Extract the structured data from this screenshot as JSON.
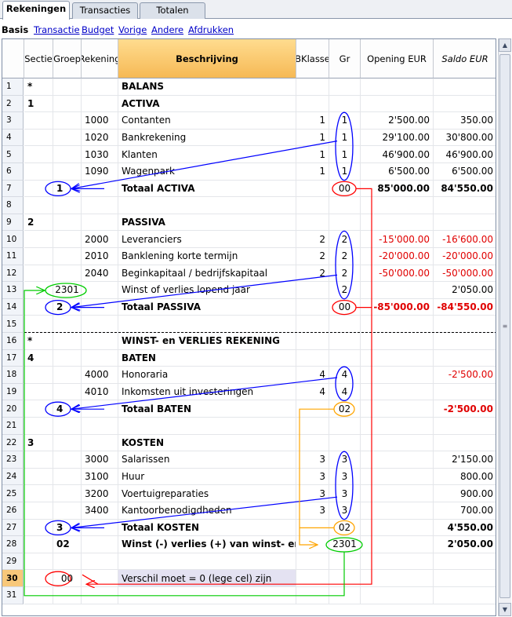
{
  "tabs": [
    {
      "label": "Rekeningen",
      "active": true
    },
    {
      "label": "Transacties",
      "active": false
    },
    {
      "label": "Totalen",
      "active": false
    }
  ],
  "subnav": [
    {
      "label": "Basis",
      "active": true
    },
    {
      "label": "Transactie",
      "active": false
    },
    {
      "label": "Budget",
      "active": false
    },
    {
      "label": "Vorige",
      "active": false
    },
    {
      "label": "Andere",
      "active": false
    },
    {
      "label": "Afdrukken",
      "active": false
    }
  ],
  "columns": [
    "Sectie",
    "Groep",
    "Rekening",
    "Beschrijving",
    "BKlasse",
    "Gr",
    "Opening EUR",
    "Saldo EUR"
  ],
  "rows": [
    {
      "n": "1",
      "sectie": "*",
      "groep": "",
      "rekening": "",
      "beschrijving": "BALANS",
      "bklasse": "",
      "gr": "",
      "opening": "",
      "saldo": "",
      "bold": true
    },
    {
      "n": "2",
      "sectie": "1",
      "groep": "",
      "rekening": "",
      "beschrijving": "ACTIVA",
      "bklasse": "",
      "gr": "",
      "opening": "",
      "saldo": "",
      "bold": true
    },
    {
      "n": "3",
      "sectie": "",
      "groep": "",
      "rekening": "1000",
      "beschrijving": "Contanten",
      "bklasse": "1",
      "gr": "1",
      "opening": "2'500.00",
      "saldo": "350.00"
    },
    {
      "n": "4",
      "sectie": "",
      "groep": "",
      "rekening": "1020",
      "beschrijving": "Bankrekening",
      "bklasse": "1",
      "gr": "1",
      "opening": "29'100.00",
      "saldo": "30'800.00"
    },
    {
      "n": "5",
      "sectie": "",
      "groep": "",
      "rekening": "1030",
      "beschrijving": "Klanten",
      "bklasse": "1",
      "gr": "1",
      "opening": "46'900.00",
      "saldo": "46'900.00"
    },
    {
      "n": "6",
      "sectie": "",
      "groep": "",
      "rekening": "1090",
      "beschrijving": "Wagenpark",
      "bklasse": "1",
      "gr": "1",
      "opening": "6'500.00",
      "saldo": "6'500.00"
    },
    {
      "n": "7",
      "sectie": "",
      "groep": "1",
      "rekening": "",
      "beschrijving": "Totaal  ACTIVA",
      "bklasse": "",
      "gr": "00",
      "opening": "85'000.00",
      "saldo": "84'550.00",
      "bold": true
    },
    {
      "n": "8",
      "sectie": "",
      "groep": "",
      "rekening": "",
      "beschrijving": "",
      "bklasse": "",
      "gr": "",
      "opening": "",
      "saldo": ""
    },
    {
      "n": "9",
      "sectie": "2",
      "groep": "",
      "rekening": "",
      "beschrijving": "PASSIVA",
      "bklasse": "",
      "gr": "",
      "opening": "",
      "saldo": "",
      "bold": true
    },
    {
      "n": "10",
      "sectie": "",
      "groep": "",
      "rekening": "2000",
      "beschrijving": "Leveranciers",
      "bklasse": "2",
      "gr": "2",
      "opening": "-15'000.00",
      "saldo": "-16'600.00",
      "neg": true
    },
    {
      "n": "11",
      "sectie": "",
      "groep": "",
      "rekening": "2010",
      "beschrijving": "Banklening korte termijn",
      "bklasse": "2",
      "gr": "2",
      "opening": "-20'000.00",
      "saldo": "-20'000.00",
      "neg": true
    },
    {
      "n": "12",
      "sectie": "",
      "groep": "",
      "rekening": "2040",
      "beschrijving": "Beginkapitaal / bedrijfskapitaal",
      "bklasse": "2",
      "gr": "2",
      "opening": "-50'000.00",
      "saldo": "-50'000.00",
      "neg": true
    },
    {
      "n": "13",
      "sectie": "",
      "groep": "2301",
      "rekening": "",
      "beschrijving": "Winst of verlies lopend jaar",
      "bklasse": "",
      "gr": "2",
      "opening": "",
      "saldo": "2'050.00"
    },
    {
      "n": "14",
      "sectie": "",
      "groep": "2",
      "rekening": "",
      "beschrijving": "Totaal PASSIVA",
      "bklasse": "",
      "gr": "00",
      "opening": "-85'000.00",
      "saldo": "-84'550.00",
      "bold": true,
      "neg": true
    },
    {
      "n": "15",
      "sectie": "",
      "groep": "",
      "rekening": "",
      "beschrijving": "",
      "bklasse": "",
      "gr": "",
      "opening": "",
      "saldo": ""
    },
    {
      "n": "16",
      "sectie": "*",
      "groep": "",
      "rekening": "",
      "beschrijving": "WINST- en VERLIES REKENING",
      "bklasse": "",
      "gr": "",
      "opening": "",
      "saldo": "",
      "bold": true
    },
    {
      "n": "17",
      "sectie": "4",
      "groep": "",
      "rekening": "",
      "beschrijving": "BATEN",
      "bklasse": "",
      "gr": "",
      "opening": "",
      "saldo": "",
      "bold": true
    },
    {
      "n": "18",
      "sectie": "",
      "groep": "",
      "rekening": "4000",
      "beschrijving": "Honoraria",
      "bklasse": "4",
      "gr": "4",
      "opening": "",
      "saldo": "-2'500.00",
      "neg": true
    },
    {
      "n": "19",
      "sectie": "",
      "groep": "",
      "rekening": "4010",
      "beschrijving": "Inkomsten uit investeringen",
      "bklasse": "4",
      "gr": "4",
      "opening": "",
      "saldo": ""
    },
    {
      "n": "20",
      "sectie": "",
      "groep": "4",
      "rekening": "",
      "beschrijving": "Totaal BATEN",
      "bklasse": "",
      "gr": "02",
      "opening": "",
      "saldo": "-2'500.00",
      "bold": true,
      "neg": true
    },
    {
      "n": "21",
      "sectie": "",
      "groep": "",
      "rekening": "",
      "beschrijving": "",
      "bklasse": "",
      "gr": "",
      "opening": "",
      "saldo": ""
    },
    {
      "n": "22",
      "sectie": "3",
      "groep": "",
      "rekening": "",
      "beschrijving": "KOSTEN",
      "bklasse": "",
      "gr": "",
      "opening": "",
      "saldo": "",
      "bold": true
    },
    {
      "n": "23",
      "sectie": "",
      "groep": "",
      "rekening": "3000",
      "beschrijving": "Salarissen",
      "bklasse": "3",
      "gr": "3",
      "opening": "",
      "saldo": "2'150.00"
    },
    {
      "n": "24",
      "sectie": "",
      "groep": "",
      "rekening": "3100",
      "beschrijving": "Huur",
      "bklasse": "3",
      "gr": "3",
      "opening": "",
      "saldo": "800.00"
    },
    {
      "n": "25",
      "sectie": "",
      "groep": "",
      "rekening": "3200",
      "beschrijving": "Voertuigreparaties",
      "bklasse": "3",
      "gr": "3",
      "opening": "",
      "saldo": "900.00"
    },
    {
      "n": "26",
      "sectie": "",
      "groep": "",
      "rekening": "3400",
      "beschrijving": "Kantoorbenodigdheden",
      "bklasse": "3",
      "gr": "3",
      "opening": "",
      "saldo": "700.00"
    },
    {
      "n": "27",
      "sectie": "",
      "groep": "3",
      "rekening": "",
      "beschrijving": "Totaal KOSTEN",
      "bklasse": "",
      "gr": "02",
      "opening": "",
      "saldo": "4'550.00",
      "bold": true
    },
    {
      "n": "28",
      "sectie": "",
      "groep": "02",
      "rekening": "",
      "beschrijving": "Winst (-) verlies (+) van winst- en verlies",
      "bklasse": "",
      "gr": "2301",
      "opening": "",
      "saldo": "2'050.00",
      "bold": true
    },
    {
      "n": "29",
      "sectie": "",
      "groep": "",
      "rekening": "",
      "beschrijving": "",
      "bklasse": "",
      "gr": "",
      "opening": "",
      "saldo": ""
    },
    {
      "n": "30",
      "sectie": "",
      "groep": "00",
      "rekening": "",
      "beschrijving": "Verschil moet = 0 (lege cel) zijn",
      "bklasse": "",
      "gr": "",
      "opening": "",
      "saldo": "",
      "selected": true,
      "highlight": true
    },
    {
      "n": "31",
      "sectie": "",
      "groep": "",
      "rekening": "",
      "beschrijving": "",
      "bklasse": "",
      "gr": "",
      "opening": "",
      "saldo": ""
    }
  ],
  "annotation_colors": {
    "group_link": "#0000ff",
    "total_00": "#ff0000",
    "result_02": "#ffa500",
    "profit_2301": "#00cc00"
  }
}
